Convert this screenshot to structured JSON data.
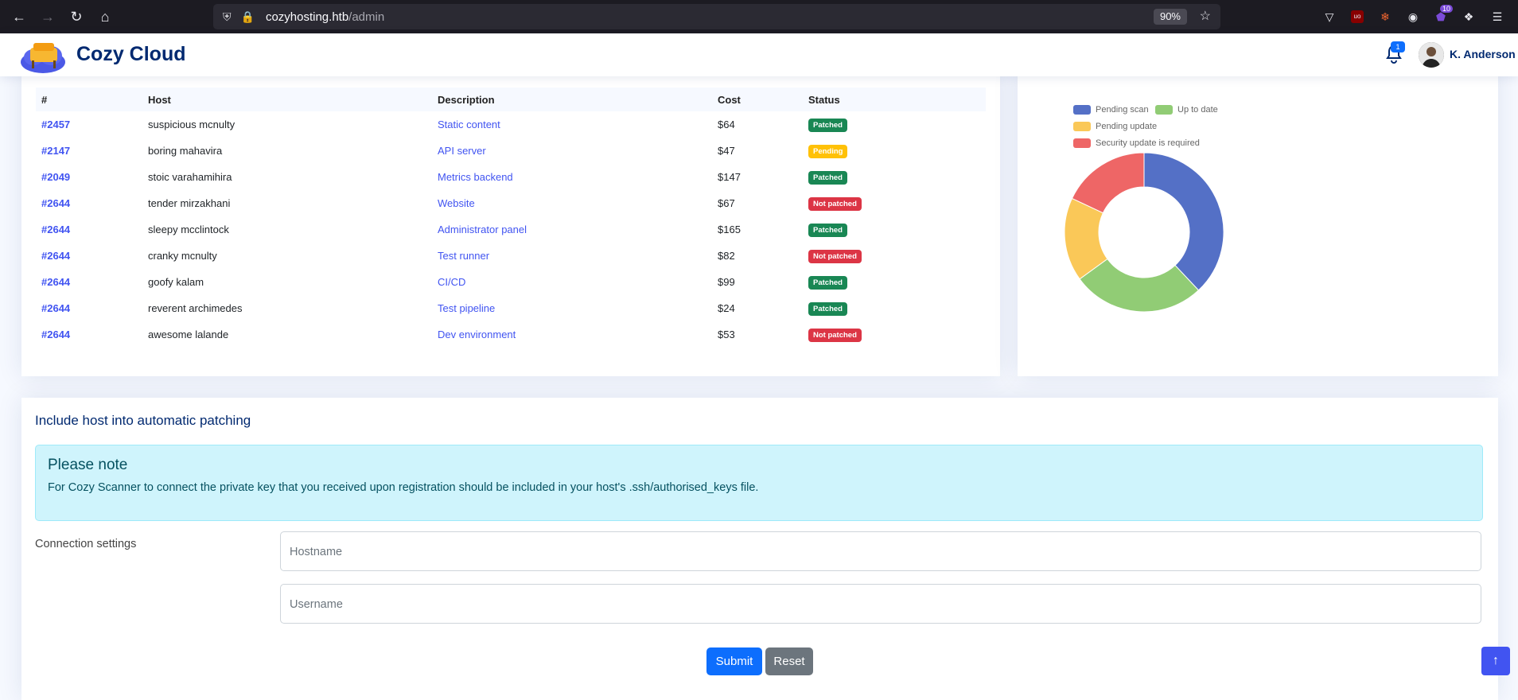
{
  "browser": {
    "url_host": "cozyhosting.htb",
    "url_path": "/admin",
    "zoom": "90%",
    "extension_badge": "10"
  },
  "header": {
    "logo_text": "Cozy Cloud",
    "notification_count": "1",
    "user_name": "K. Anderson"
  },
  "table": {
    "columns": [
      "#",
      "Host",
      "Description",
      "Cost",
      "Status"
    ],
    "rows": [
      {
        "id": "#2457",
        "host": "suspicious mcnulty",
        "description": "Static content",
        "cost": "$64",
        "status": "Patched",
        "status_kind": "patched"
      },
      {
        "id": "#2147",
        "host": "boring mahavira",
        "description": "API server",
        "cost": "$47",
        "status": "Pending",
        "status_kind": "pending"
      },
      {
        "id": "#2049",
        "host": "stoic varahamihira",
        "description": "Metrics backend",
        "cost": "$147",
        "status": "Patched",
        "status_kind": "patched"
      },
      {
        "id": "#2644",
        "host": "tender mirzakhani",
        "description": "Website",
        "cost": "$67",
        "status": "Not patched",
        "status_kind": "notpatched"
      },
      {
        "id": "#2644",
        "host": "sleepy mcclintock",
        "description": "Administrator panel",
        "cost": "$165",
        "status": "Patched",
        "status_kind": "patched"
      },
      {
        "id": "#2644",
        "host": "cranky mcnulty",
        "description": "Test runner",
        "cost": "$82",
        "status": "Not patched",
        "status_kind": "notpatched"
      },
      {
        "id": "#2644",
        "host": "goofy kalam",
        "description": "CI/CD",
        "cost": "$99",
        "status": "Patched",
        "status_kind": "patched"
      },
      {
        "id": "#2644",
        "host": "reverent archimedes",
        "description": "Test pipeline",
        "cost": "$24",
        "status": "Patched",
        "status_kind": "patched"
      },
      {
        "id": "#2644",
        "host": "awesome lalande",
        "description": "Dev environment",
        "cost": "$53",
        "status": "Not patched",
        "status_kind": "notpatched"
      }
    ]
  },
  "chart_data": {
    "type": "pie",
    "categories": [
      "Pending scan",
      "Up to date",
      "Pending update",
      "Security update is required"
    ],
    "values": [
      38,
      27,
      17,
      18
    ],
    "colors": [
      "#5470c6",
      "#91cc75",
      "#fac858",
      "#ee6666"
    ],
    "legend_position": "top-left",
    "style": "donut"
  },
  "form": {
    "title": "Include host into automatic patching",
    "alert_heading": "Please note",
    "alert_text": "For Cozy Scanner to connect the private key that you received upon registration should be included in your host's .ssh/authorised_keys file.",
    "connection_label": "Connection settings",
    "hostname_placeholder": "Hostname",
    "username_placeholder": "Username",
    "submit_label": "Submit",
    "reset_label": "Reset"
  },
  "icons": {
    "back": "arrow-left-icon",
    "forward": "arrow-right-icon",
    "reload": "reload-icon",
    "home": "home-icon",
    "notification": "bell-icon",
    "back_to_top": "arrow-up-icon"
  }
}
